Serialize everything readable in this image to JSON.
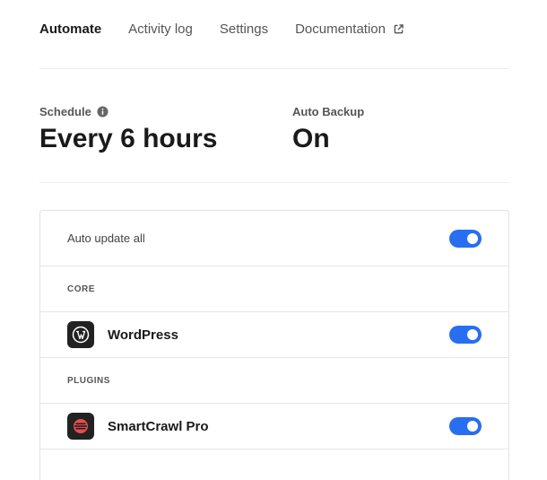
{
  "nav": {
    "tabs": [
      {
        "label": "Automate",
        "active": true
      },
      {
        "label": "Activity log",
        "active": false
      },
      {
        "label": "Settings",
        "active": false
      },
      {
        "label": "Documentation",
        "active": false,
        "icon": "external-link-icon"
      }
    ]
  },
  "stats": {
    "schedule": {
      "label": "Schedule",
      "value": "Every 6 hours",
      "icon": "info-icon"
    },
    "auto_backup": {
      "label": "Auto Backup",
      "value": "On"
    }
  },
  "panel": {
    "auto_update_all": {
      "label": "Auto update all",
      "enabled": true
    },
    "core": {
      "section_label": "CORE",
      "items": [
        {
          "name": "WordPress",
          "icon": "wordpress-logo-icon",
          "enabled": true
        }
      ]
    },
    "plugins": {
      "section_label": "PLUGINS",
      "items": [
        {
          "name": "SmartCrawl Pro",
          "icon": "smartcrawl-logo-icon",
          "enabled": true
        }
      ]
    }
  },
  "colors": {
    "toggle_on": "#286ef1",
    "text_primary": "#1a1a1a",
    "text_secondary": "#555555",
    "smartcrawl_red": "#e84d4d"
  }
}
